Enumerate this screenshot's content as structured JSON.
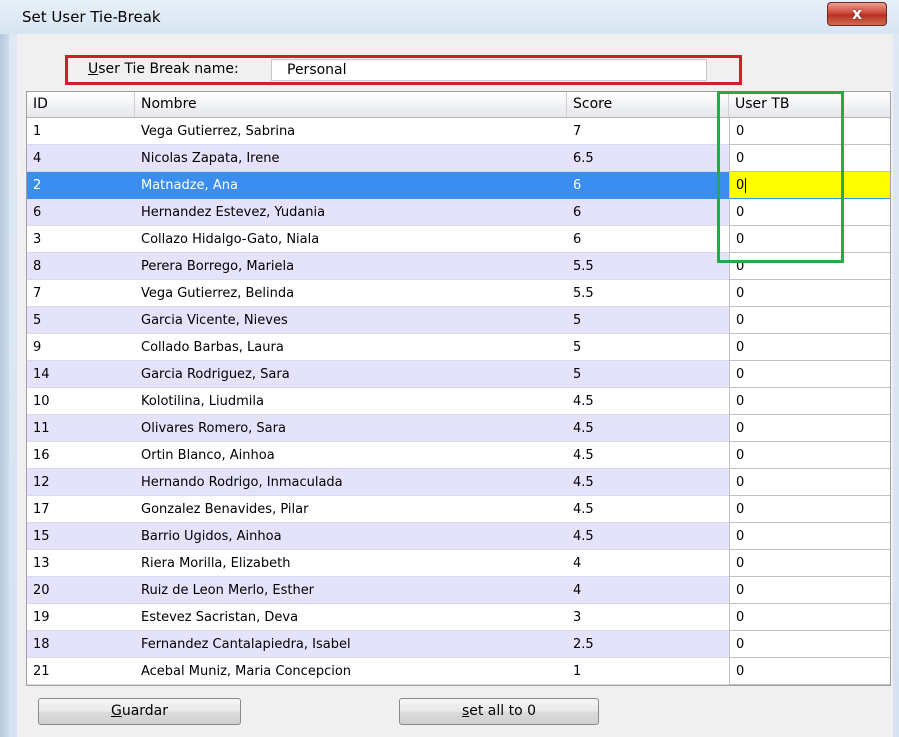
{
  "window": {
    "title": "Set User Tie-Break",
    "close_glyph": "x"
  },
  "tiebreak": {
    "label_mnemonic": "U",
    "label_rest": "ser Tie Break name:",
    "value": "Personal"
  },
  "grid": {
    "headers": {
      "id": "ID",
      "nombre": "Nombre",
      "score": "Score",
      "user_tb": "User TB"
    },
    "rows": [
      {
        "id": "1",
        "nombre": "Vega Gutierrez, Sabrina",
        "score": "7",
        "user_tb": "0"
      },
      {
        "id": "4",
        "nombre": "Nicolas Zapata, Irene",
        "score": "6.5",
        "user_tb": "0"
      },
      {
        "id": "2",
        "nombre": "Matnadze, Ana",
        "score": "6",
        "user_tb": "0"
      },
      {
        "id": "6",
        "nombre": "Hernandez Estevez, Yudania",
        "score": "6",
        "user_tb": "0"
      },
      {
        "id": "3",
        "nombre": "Collazo Hidalgo-Gato, Niala",
        "score": "6",
        "user_tb": "0"
      },
      {
        "id": "8",
        "nombre": "Perera Borrego, Mariela",
        "score": "5.5",
        "user_tb": "0"
      },
      {
        "id": "7",
        "nombre": "Vega Gutierrez, Belinda",
        "score": "5.5",
        "user_tb": "0"
      },
      {
        "id": "5",
        "nombre": "Garcia Vicente, Nieves",
        "score": "5",
        "user_tb": "0"
      },
      {
        "id": "9",
        "nombre": "Collado Barbas, Laura",
        "score": "5",
        "user_tb": "0"
      },
      {
        "id": "14",
        "nombre": "Garcia Rodriguez, Sara",
        "score": "5",
        "user_tb": "0"
      },
      {
        "id": "10",
        "nombre": "Kolotilina, Liudmila",
        "score": "4.5",
        "user_tb": "0"
      },
      {
        "id": "11",
        "nombre": "Olivares Romero, Sara",
        "score": "4.5",
        "user_tb": "0"
      },
      {
        "id": "16",
        "nombre": "Ortin Blanco, Ainhoa",
        "score": "4.5",
        "user_tb": "0"
      },
      {
        "id": "12",
        "nombre": "Hernando Rodrigo, Inmaculada",
        "score": "4.5",
        "user_tb": "0"
      },
      {
        "id": "17",
        "nombre": "Gonzalez Benavides, Pilar",
        "score": "4.5",
        "user_tb": "0"
      },
      {
        "id": "15",
        "nombre": "Barrio Ugidos, Ainhoa",
        "score": "4.5",
        "user_tb": "0"
      },
      {
        "id": "13",
        "nombre": "Riera Morilla, Elizabeth",
        "score": "4",
        "user_tb": "0"
      },
      {
        "id": "20",
        "nombre": "Ruiz de Leon Merlo, Esther",
        "score": "4",
        "user_tb": "0"
      },
      {
        "id": "19",
        "nombre": "Estevez Sacristan, Deva",
        "score": "3",
        "user_tb": "0"
      },
      {
        "id": "18",
        "nombre": "Fernandez Cantalapiedra, Isabel",
        "score": "2.5",
        "user_tb": "0"
      },
      {
        "id": "21",
        "nombre": "Acebal Muniz, Maria Concepcion",
        "score": "1",
        "user_tb": "0"
      }
    ],
    "selected_index": 2
  },
  "buttons": {
    "guardar": {
      "mnemonic": "G",
      "rest": "uardar"
    },
    "set_all": {
      "mnemonic": "s",
      "rest": "et all to 0"
    }
  },
  "colors": {
    "row_alt": "#e4e3fb",
    "selection": "#3b8ef0",
    "edit_highlight": "#ffff00",
    "annotation_red": "#d11f2a",
    "annotation_green": "#29a844"
  }
}
